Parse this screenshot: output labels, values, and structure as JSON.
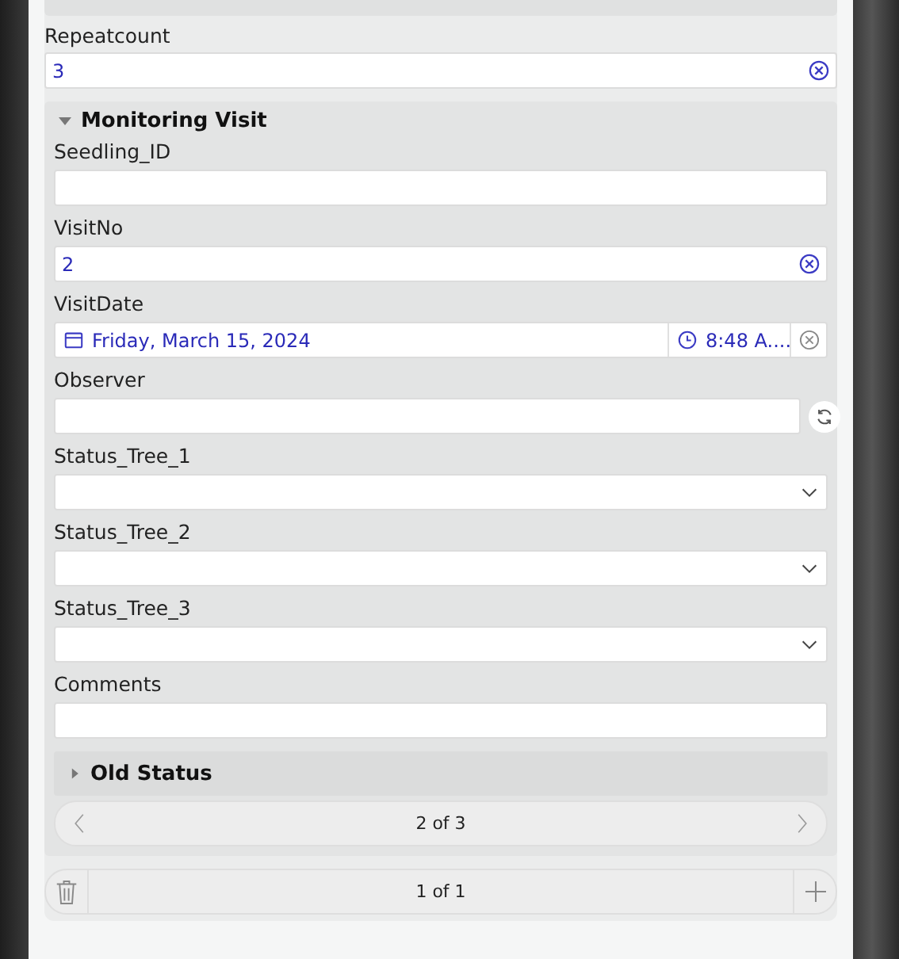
{
  "repeat_field": {
    "label": "Repeatcount",
    "value": "3",
    "clearable": true
  },
  "group": {
    "title": "Monitoring Visit",
    "expanded": true,
    "fields": [
      {
        "kind": "text",
        "label": "Seedling_ID",
        "clearable": false
      },
      {
        "kind": "text",
        "label": "VisitNo",
        "value": "2",
        "clearable": true
      },
      {
        "kind": "datetime",
        "label": "VisitDate",
        "date": "Friday, March 15, 2024",
        "time": "8:48 A....",
        "clearable": true
      },
      {
        "kind": "refresh",
        "label": "Observer"
      },
      {
        "kind": "select",
        "label": "Status_Tree_1"
      },
      {
        "kind": "select",
        "label": "Status_Tree_2"
      },
      {
        "kind": "select",
        "label": "Status_Tree_3"
      },
      {
        "kind": "text",
        "label": "Comments",
        "clearable": false
      }
    ],
    "subgroup": {
      "title": "Old Status",
      "expanded": false
    },
    "pager": "2 of 3"
  },
  "footer": {
    "pager": "1 of 1"
  }
}
